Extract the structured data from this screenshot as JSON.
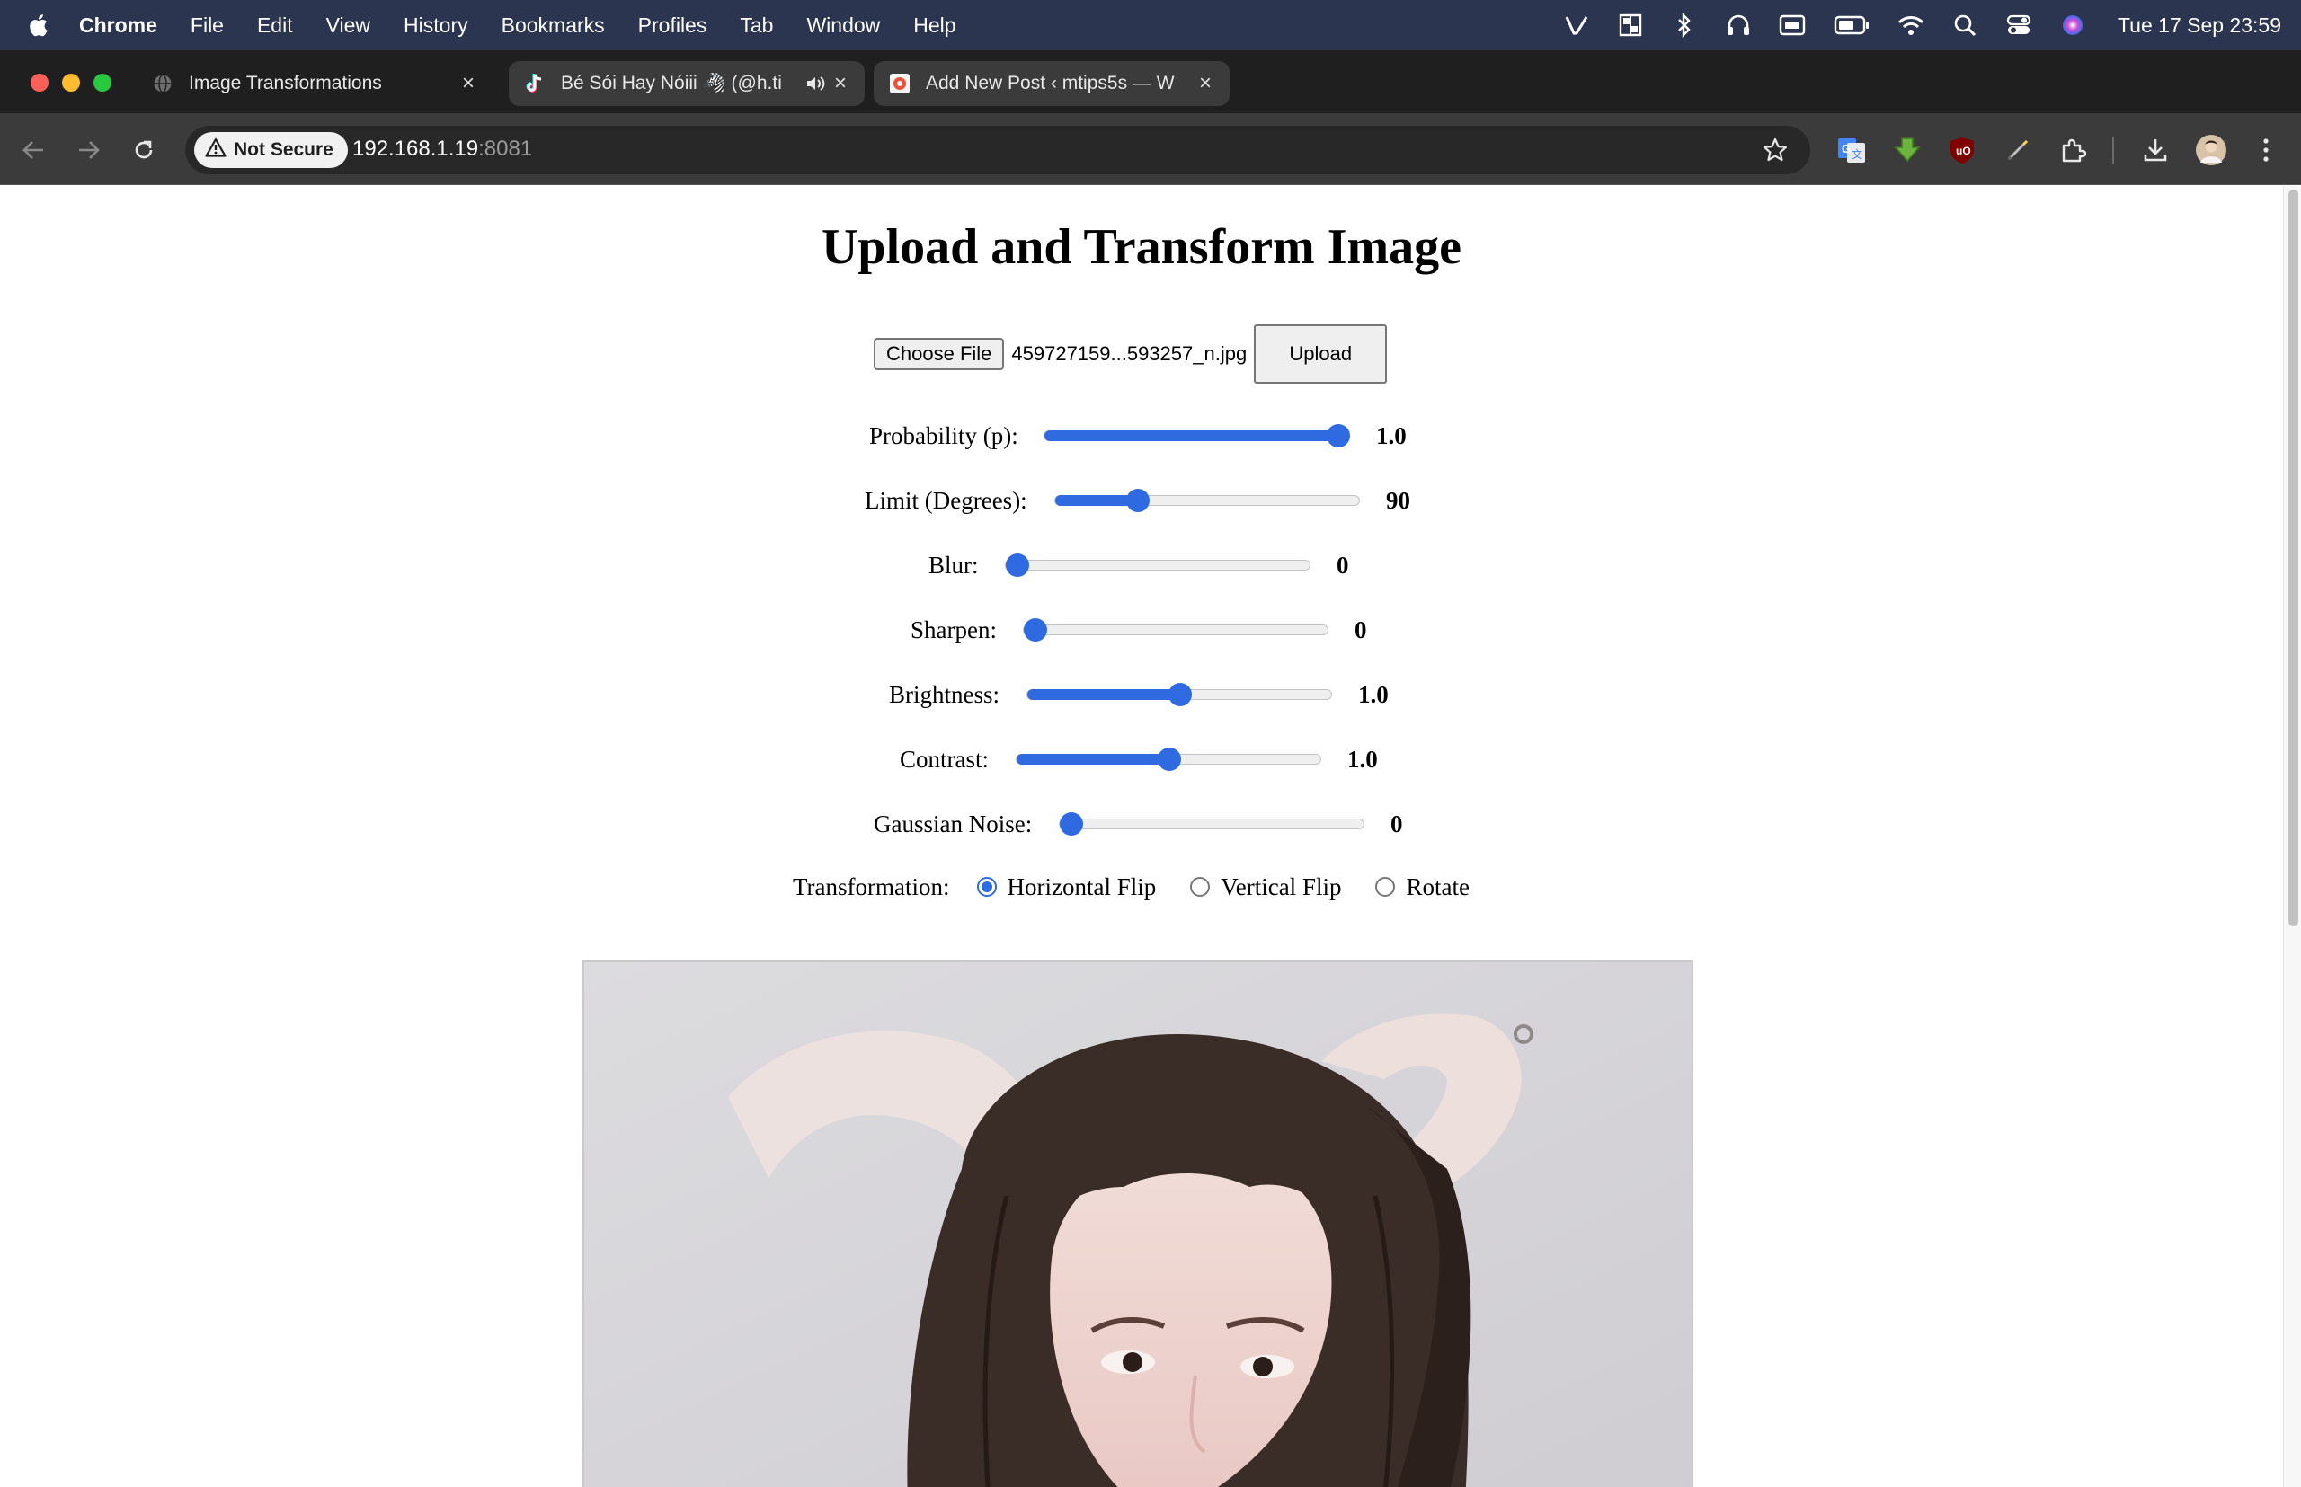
{
  "menubar": {
    "app": "Chrome",
    "items": [
      "File",
      "Edit",
      "View",
      "History",
      "Bookmarks",
      "Profiles",
      "Tab",
      "Window",
      "Help"
    ],
    "clock": "Tue 17 Sep  23:59"
  },
  "tabs": [
    {
      "title": "Image Transformations",
      "favicon": "globe-icon"
    },
    {
      "title": "Bé Sói Hay Nóiii 🦓 (@h.ti",
      "favicon": "tiktok-icon"
    },
    {
      "title": "Add New Post ‹ mtips5s — W",
      "favicon": "wordpress-icon"
    }
  ],
  "toolbar": {
    "security_label": "Not Secure",
    "url_host": "192.168.1.19",
    "url_port": ":8081"
  },
  "page": {
    "title": "Upload and Transform Image",
    "choose_file_label": "Choose File",
    "file_name": "459727159...593257_n.jpg",
    "upload_label": "Upload",
    "sliders": [
      {
        "label": "Probability (p):",
        "value_text": "1.0",
        "fraction": 1.0
      },
      {
        "label": "Limit (Degrees):",
        "value_text": "90",
        "fraction": 0.25
      },
      {
        "label": "Blur:",
        "value_text": "0",
        "fraction": 0.0
      },
      {
        "label": "Sharpen:",
        "value_text": "0",
        "fraction": 0.0
      },
      {
        "label": "Brightness:",
        "value_text": "1.0",
        "fraction": 0.5
      },
      {
        "label": "Contrast:",
        "value_text": "1.0",
        "fraction": 0.5
      },
      {
        "label": "Gaussian Noise:",
        "value_text": "0",
        "fraction": 0.0
      }
    ],
    "transformation_label": "Transformation:",
    "transformations": [
      {
        "label": "Horizontal Flip",
        "checked": true
      },
      {
        "label": "Vertical Flip",
        "checked": false
      },
      {
        "label": "Rotate",
        "checked": false
      }
    ]
  },
  "colors": {
    "accent": "#2f6ae0",
    "menubar": "#2b3550",
    "tabstrip": "#1f1f1f",
    "toolbar": "#3b3b3b"
  }
}
